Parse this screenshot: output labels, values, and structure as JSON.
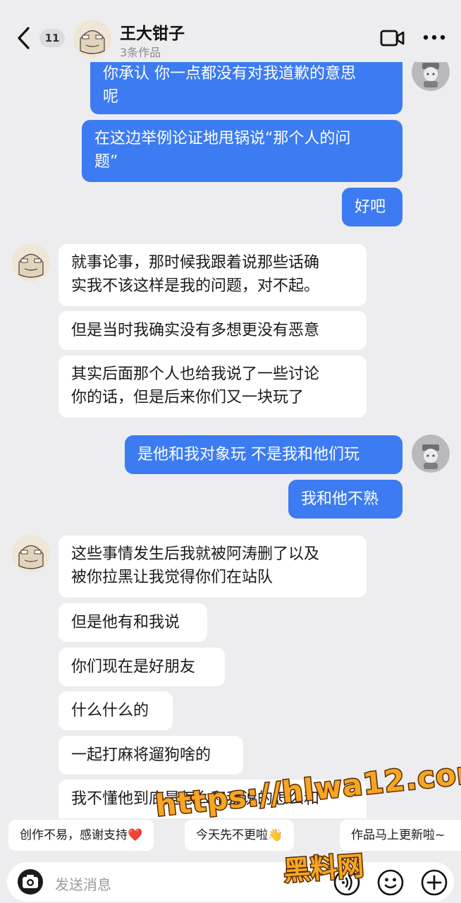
{
  "header": {
    "unread_count": "11",
    "contact_name": "王大钳子",
    "subtitle": "3条作品"
  },
  "messages": [
    {
      "side": "out",
      "text": "你承认 你一点都没有对我道歉的意思\n呢"
    },
    {
      "side": "out",
      "text": "在这边举例论证地甩锅说“那个人的问\n题”"
    },
    {
      "side": "out",
      "text": "好吧"
    },
    {
      "side": "in",
      "text": "就事论事，那时候我跟着说那些话确\n实我不该这样是我的问题，对不起。"
    },
    {
      "side": "in",
      "text": "但是当时我确实没有多想更没有恶意"
    },
    {
      "side": "in",
      "text": "其实后面那个人也给我说了一些讨论\n你的话，但是后来你们又一块玩了"
    },
    {
      "side": "out",
      "text": "是他和我对象玩 不是我和他们玩"
    },
    {
      "side": "out",
      "text": "我和他不熟"
    },
    {
      "side": "in",
      "text": "这些事情发生后我就被阿涛删了以及\n被你拉黑让我觉得你们在站队"
    },
    {
      "side": "in",
      "text": "但是他有和我说"
    },
    {
      "side": "in",
      "text": "你们现在是好朋友"
    },
    {
      "side": "in",
      "text": "什么什么的"
    },
    {
      "side": "in",
      "text": "一起打麻将遛狗啥的"
    },
    {
      "side": "in",
      "text": "我不懂他到底是怎么和我说的怎么和"
    }
  ],
  "quick_replies": [
    {
      "text": "创作不易，感谢支持",
      "suffix": "❤️"
    },
    {
      "text": "今天先不更啦",
      "suffix": "👋"
    },
    {
      "text": "作品马上更新啦~"
    }
  ],
  "input": {
    "placeholder": "发送消息"
  },
  "watermark": {
    "url": "https://hlwa12.com",
    "cn": "黑料网"
  },
  "colors": {
    "outgoing_bubble": "#3c7bf2",
    "incoming_bubble": "#ffffff",
    "background": "#ededef"
  }
}
